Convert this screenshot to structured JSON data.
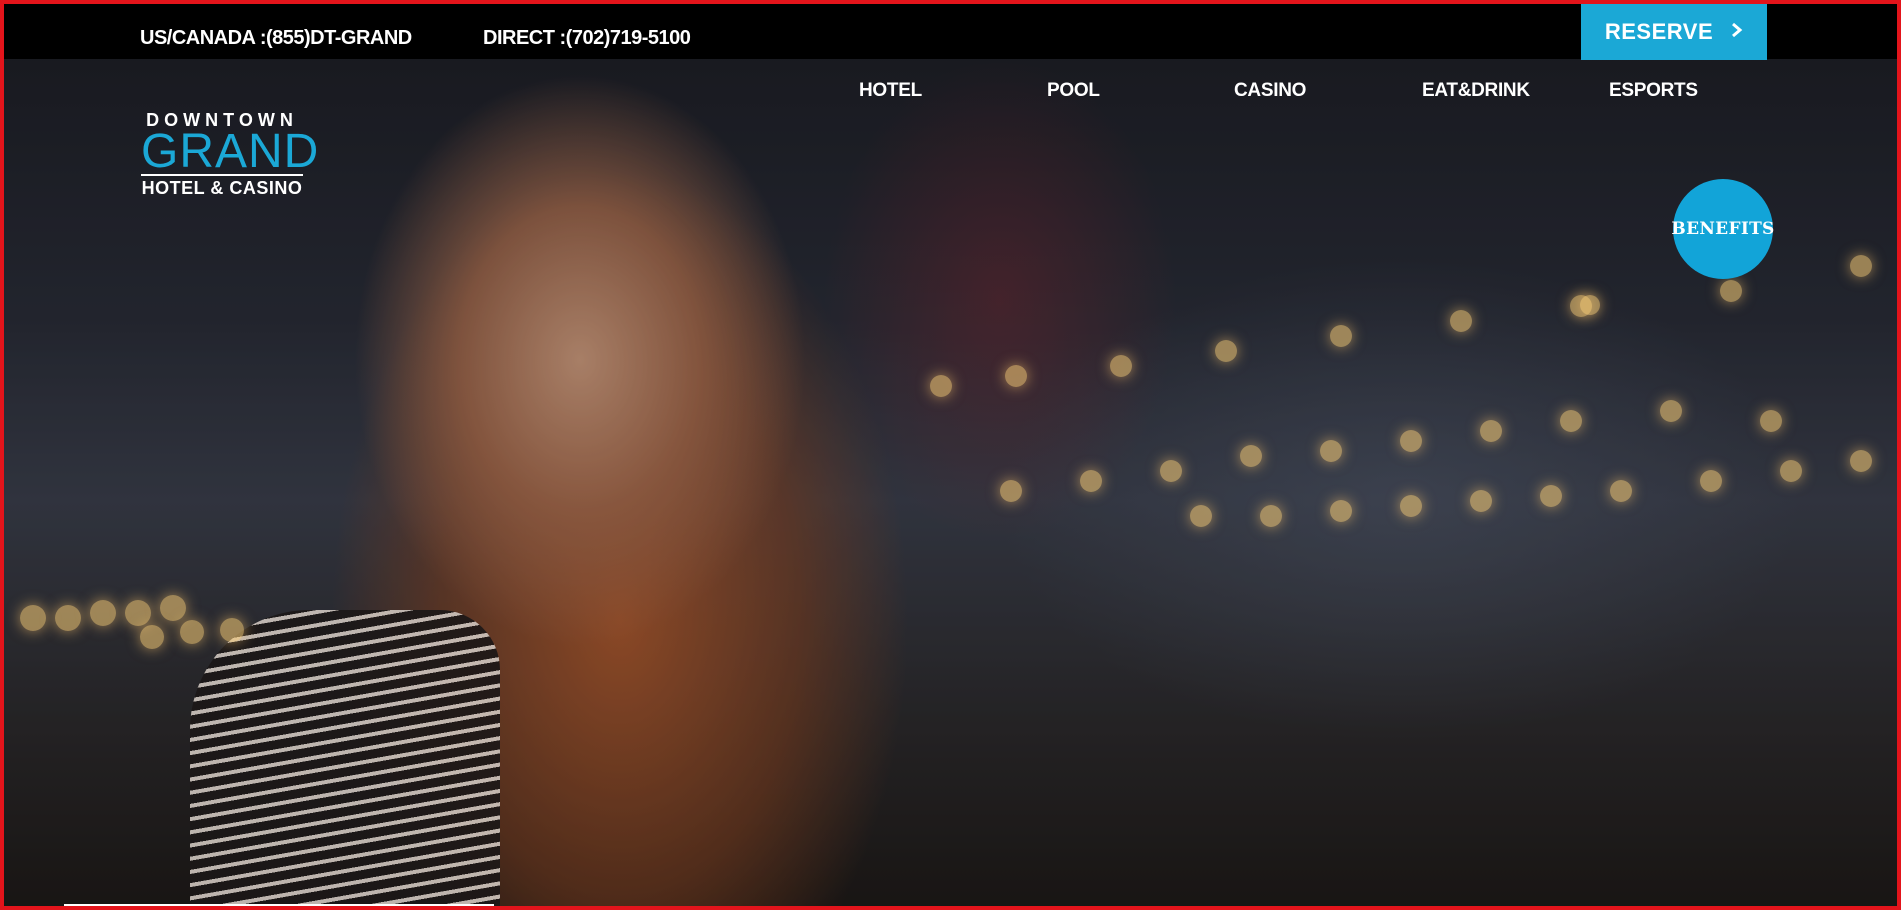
{
  "topbar": {
    "us_canada": "US/CANADA :(855)DT-GRAND",
    "direct": "DIRECT :(702)719-5100",
    "reserve_label": "RESERVE",
    "reserve_icon": "chevron-right-icon"
  },
  "logo": {
    "line1": "DOWNTOWN",
    "line2": "GRAND",
    "line3": "HOTEL & CASINO"
  },
  "nav": {
    "items": [
      {
        "label": "HOTEL"
      },
      {
        "label": "POOL"
      },
      {
        "label": "CASINO"
      },
      {
        "label": "EAT&DRINK"
      },
      {
        "label": "ESPORTS"
      }
    ]
  },
  "benefits": {
    "label": "BENEFITS"
  },
  "colors": {
    "accent": "#1ba8d6",
    "frame": "#e3141b",
    "topbar_bg": "#000000"
  }
}
